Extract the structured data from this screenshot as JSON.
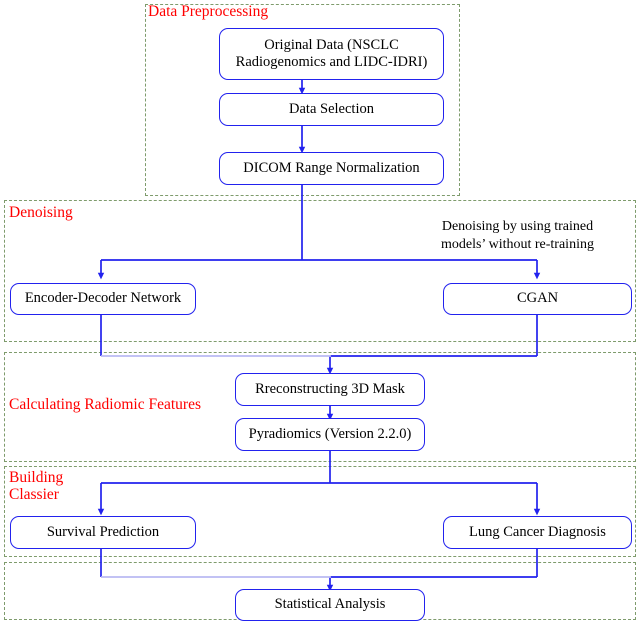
{
  "figure": {
    "type": "flowchart",
    "title": "Radiomics denoising and classification pipeline",
    "colors": {
      "node_border": "#2222ee",
      "section_border": "#7e9b6c",
      "section_label": "#ff0000",
      "connector": "#2222ee",
      "connector_faded": "#b9b9f2",
      "text": "#000000",
      "background": "#ffffff"
    }
  },
  "sections": [
    {
      "id": "preprocessing",
      "label": "Data Preprocessing"
    },
    {
      "id": "denoising",
      "label": "Denoising"
    },
    {
      "id": "radiomics",
      "label": "Calculating Radiomic Features"
    },
    {
      "id": "classifier",
      "label": "Building\nClassier"
    },
    {
      "id": "analysis",
      "label": ""
    }
  ],
  "nodes": [
    {
      "id": "original-data",
      "label": "Original Data (NSCLC\nRadiogenomics and LIDC-IDRI)"
    },
    {
      "id": "data-selection",
      "label": "Data Selection"
    },
    {
      "id": "dicom-range-normalization",
      "label": "DICOM Range Normalization"
    },
    {
      "id": "encoder-decoder-network",
      "label": "Encoder-Decoder Network"
    },
    {
      "id": "cgan",
      "label": "CGAN"
    },
    {
      "id": "reconstructing-3d-mask",
      "label": "Rreconstructing 3D Mask"
    },
    {
      "id": "pyradiomics",
      "label": "Pyradiomics (Version 2.2.0)"
    },
    {
      "id": "survival-prediction",
      "label": "Survival Prediction"
    },
    {
      "id": "lung-cancer-diagnosis",
      "label": "Lung Cancer Diagnosis"
    },
    {
      "id": "statistical-analysis",
      "label": "Statistical Analysis"
    }
  ],
  "annotations": [
    {
      "id": "denoising-note",
      "text": "Denoising by using trained\nmodels’ without re-training"
    }
  ]
}
